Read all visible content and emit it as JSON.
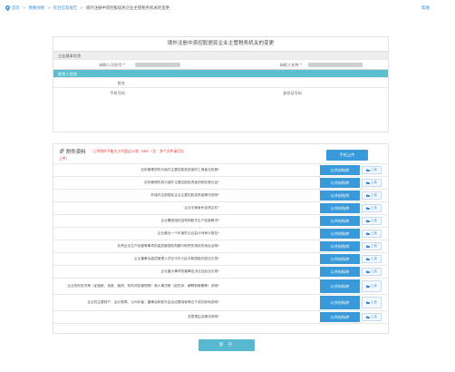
{
  "breadcrumb": {
    "items": [
      "首页",
      "我要办税",
      "综合信息报告"
    ],
    "current": "境外注册中资控股居民企业主管税务机关的变更"
  },
  "help_link": "帮助",
  "page_title": "境外注册中资控股居民企业主管税务机关的变更",
  "basic_section": {
    "title": "企业基本信息",
    "taxpayer_id_label": "纳税人识别号",
    "taxpayer_name_label": "纳税人名称"
  },
  "contact_section": {
    "title": "联系人信息",
    "name_label": "姓名",
    "phone_label": "手机号码",
    "id_label": "身份证号码"
  },
  "attachment": {
    "title": "附件资料",
    "note_line1": "（上传附件不能大小不超过20兆（MB）（注：多个文件请打包",
    "note_line2": "上传）",
    "phone_upload_label": "手机上传",
    "lib_button_label": "公共材料库",
    "upload_button_label": "上传",
    "rows": [
      "实际管理机构与境外主要控股投资者的工商营业执照",
      "实际管理机构与境外主要控股投资者的税务登记证",
      "非境内注册居民企业主要控股投资者情况说明",
      "企业法律身份证明文件",
      "企业集团组织结构和股东生产经营概况",
      "企业最近一个年度的公证会计师审计报告",
      "负责企业生产经营等事项的高层管理机构履行职责的场所的地址证明",
      "企业董事及高层管理人员在中华人民共和国境内居住记录",
      "企业重大事项的董事会决议及会议记录",
      "企业的财务决策（如借款、放款、融资、财务风险管理等）和人事决策（如任命、解聘和薪酬等）说明",
      "企业的主要财产、会计账簿、公司印章、董事会和股东会议纪要档案等位于或存放地说明",
      "变更理由及情况说明"
    ]
  },
  "save_label": "保 存"
}
